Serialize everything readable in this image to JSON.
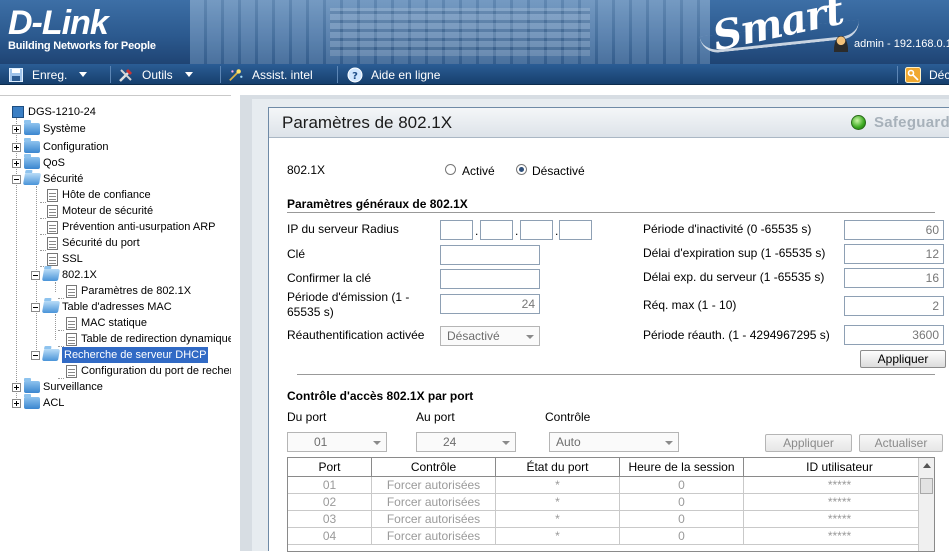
{
  "header": {
    "brand": "D-Link",
    "tagline": "Building Networks for People",
    "product_logo": "Smart",
    "user_text": "admin - 192.168.0.1"
  },
  "toolbar": {
    "save_label": "Enreg.",
    "tools_label": "Outils",
    "wizard_label": "Assist. intel",
    "help_label": "Aide en ligne",
    "logout_label": "Déco"
  },
  "tree": {
    "root": "DGS-1210-24",
    "items": [
      {
        "label": "Système"
      },
      {
        "label": "Configuration"
      },
      {
        "label": "QoS"
      },
      {
        "label": "Sécurité"
      },
      {
        "label": "Hôte de confiance"
      },
      {
        "label": "Moteur de sécurité"
      },
      {
        "label": "Prévention anti-usurpation ARP"
      },
      {
        "label": "Sécurité du port"
      },
      {
        "label": "SSL"
      },
      {
        "label": "802.1X"
      },
      {
        "label": "Paramètres de 802.1X"
      },
      {
        "label": "Table d'adresses MAC"
      },
      {
        "label": "MAC statique"
      },
      {
        "label": "Table de redirection dynamique"
      },
      {
        "label": "Recherche de serveur DHCP"
      },
      {
        "label": "Configuration du port de recherche"
      },
      {
        "label": "Surveillance"
      },
      {
        "label": "ACL"
      }
    ]
  },
  "page": {
    "title": "Paramètres de 802.1X",
    "safeguard": "Safeguard",
    "dot1x_label": "802.1X",
    "enabled_label": "Activé",
    "disabled_label": "Désactivé",
    "dot1x_state": "disabled"
  },
  "general": {
    "section_title": "Paramètres généraux de 802.1X",
    "radius_ip_label": "IP du serveur Radius",
    "radius_ip": [
      "",
      "",
      "",
      ""
    ],
    "key_label": "Clé",
    "key_value": "",
    "confirm_key_label": "Confirmer la clé",
    "confirm_key_value": "",
    "tx_period_label_1": "Période d'émission (1 -",
    "tx_period_label_2": "65535 s)",
    "tx_period_value": "24",
    "reauth_enabled_label": "Réauthentification activée",
    "reauth_enabled_value": "Désactivé",
    "quiet_period_label": "Période d'inactivité (0 -65535 s)",
    "quiet_period_value": "60",
    "supp_timeout_label": "Délai d'expiration sup (1 -65535 s)",
    "supp_timeout_value": "12",
    "server_timeout_label": "Délai exp. du serveur (1 -65535 s)",
    "server_timeout_value": "16",
    "max_req_label": "Réq. max (1 - 10)",
    "max_req_value": "2",
    "reauth_period_label": "Période réauth. (1 - 4294967295 s)",
    "reauth_period_value": "3600",
    "apply_label": "Appliquer"
  },
  "port_access": {
    "section_title": "Contrôle d'accès 802.1X par port",
    "from_port_label": "Du port",
    "from_port_value": "01",
    "to_port_label": "Au port",
    "to_port_value": "24",
    "control_label": "Contrôle",
    "control_value": "Auto",
    "apply_label": "Appliquer",
    "refresh_label": "Actualiser"
  },
  "table": {
    "columns": [
      "Port",
      "Contrôle",
      "État du port",
      "Heure de la session",
      "ID utilisateur"
    ],
    "rows": [
      [
        "01",
        "Forcer autorisées",
        "*",
        "0",
        "*****"
      ],
      [
        "02",
        "Forcer autorisées",
        "*",
        "0",
        "*****"
      ],
      [
        "03",
        "Forcer autorisées",
        "*",
        "0",
        "*****"
      ],
      [
        "04",
        "Forcer autorisées",
        "*",
        "0",
        "*****"
      ]
    ]
  },
  "colors": {
    "header_blue": "#2c5a8f",
    "toolbar_blue": "#163f6d",
    "selection": "#316ac5",
    "safeguard_green": "#3aa820"
  }
}
